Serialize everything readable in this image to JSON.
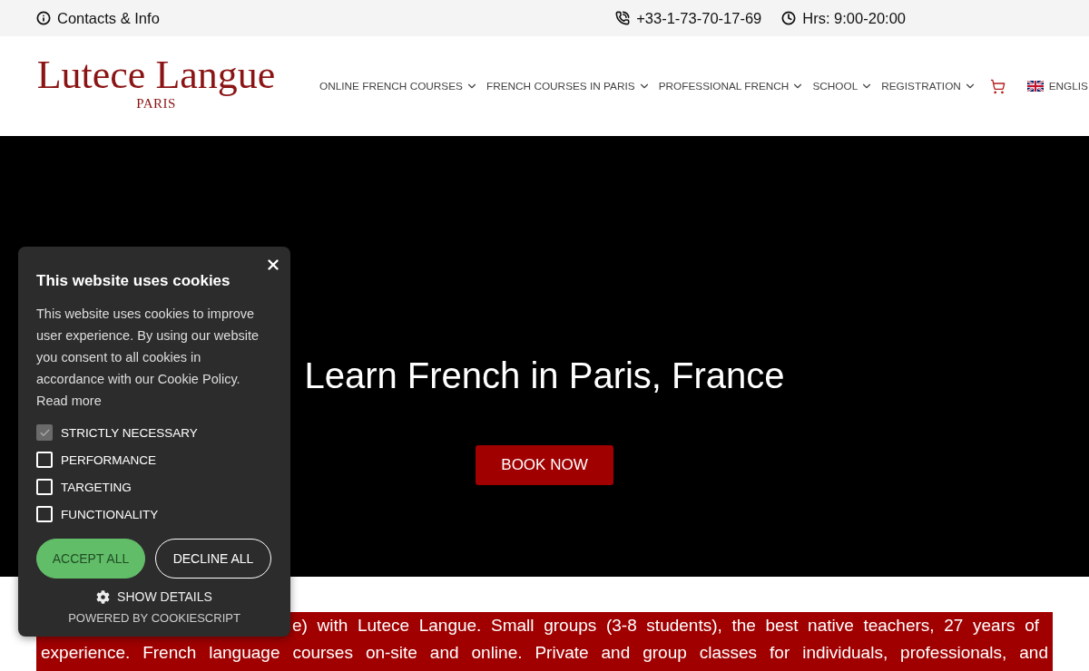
{
  "top_bar": {
    "contacts": "Contacts & Info",
    "phone": "+33-1-73-70-17-69",
    "hours": "Hrs: 9:00-20:00"
  },
  "header": {
    "logo": {
      "name": "Lutece Langue",
      "city": "PARIS"
    },
    "nav": [
      {
        "label": "ONLINE FRENCH COURSES",
        "has_dropdown": true
      },
      {
        "label": "FRENCH COURSES IN PARIS",
        "has_dropdown": true
      },
      {
        "label": "PROFESSIONAL FRENCH",
        "has_dropdown": true
      },
      {
        "label": "SCHOOL",
        "has_dropdown": true
      },
      {
        "label": "REGISTRATION",
        "has_dropdown": true
      }
    ],
    "language": "ENGLIS"
  },
  "hero": {
    "title": "Learn French in Paris, France",
    "button": "BOOK NOW"
  },
  "intro_banner": {
    "lines": [
      "e) with Lutece Langue. Small groups (3-8 students), the best native teachers, 27 years of",
      "experience. French language courses on-site and online. Private and group classes for individuals, professionals, and"
    ]
  },
  "cookie_dialog": {
    "title": "This website uses cookies",
    "text": "This website uses cookies to improve user experience. By using our website you consent to all cookies in accordance with our Cookie Policy.",
    "read_more": "Read more",
    "categories": [
      {
        "label": "STRICTLY NECESSARY",
        "checked": true,
        "disabled": true
      },
      {
        "label": "PERFORMANCE",
        "checked": false,
        "disabled": false
      },
      {
        "label": "TARGETING",
        "checked": false,
        "disabled": false
      },
      {
        "label": "FUNCTIONALITY",
        "checked": false,
        "disabled": false
      }
    ],
    "buttons": [
      {
        "label": "ACCEPT ALL",
        "kind": "accept"
      },
      {
        "label": "DECLINE ALL",
        "kind": "decline"
      }
    ],
    "show_details": "SHOW DETAILS",
    "powered_by": "POWERED BY COOKIESCRIPT"
  }
}
